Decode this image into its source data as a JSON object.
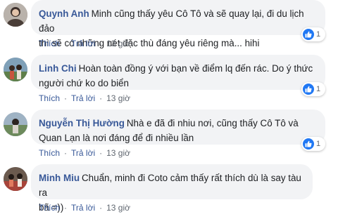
{
  "colors": {
    "author": "#385898",
    "bubble": "#f2f3f5",
    "like_badge": "#2078f4",
    "meta": "#606770"
  },
  "action_labels": {
    "like": "Thích",
    "reply": "Trả lời",
    "separator": "·"
  },
  "comments": [
    {
      "author": "Quynh Anh",
      "text": "Minh cũng thấy yêu Cô Tô và sẽ quay lại, đi du lịch đảo thì sẽ có những nét đặc thù đáng yêu riêng mà... hihi",
      "line1": "Minh cũng thấy yêu Cô Tô và sẽ quay lại, đi du lịch đảo",
      "line2": "thì sẽ có những nét đặc thù đáng yêu riêng mà... hihi",
      "reaction_icon": "like-icon",
      "reaction_count": "1",
      "time": "13 giờ"
    },
    {
      "author": "Linh Chi",
      "text": "Hoàn toàn đồng ý với bạn về điểm lq đến rác. Do ý thức người chứ ko do biển",
      "line1": "Hoàn toàn đồng ý với bạn về điểm lq đến rác. Do ý thức",
      "line2": "người chứ ko do biển",
      "reaction_icon": "like-icon",
      "reaction_count": "1",
      "time": "13 giờ"
    },
    {
      "author": "Nguyễn Thị Hường",
      "text": "Nhà e đã đi nhiu nơi, cũng thấy Cô Tô và Quan Lạn là nơi đáng để đi nhiều lần",
      "line1": "Nhà e đã đi nhiu nơi, cũng thấy Cô Tô và",
      "line2": "Quan Lạn là nơi đáng để đi nhiều lần",
      "reaction_icon": "like-icon",
      "reaction_count": "1",
      "time": "13 giờ"
    },
    {
      "author": "Minh Miu",
      "text": "Chuẩn, minh đi Coto cảm thấy rất thích dù là say tàu ra bã =))",
      "line1": "Chuẩn, minh đi Coto cảm thấy rất thích dù là say tàu ra",
      "line2": "bã =))",
      "time": "13 giờ"
    }
  ]
}
